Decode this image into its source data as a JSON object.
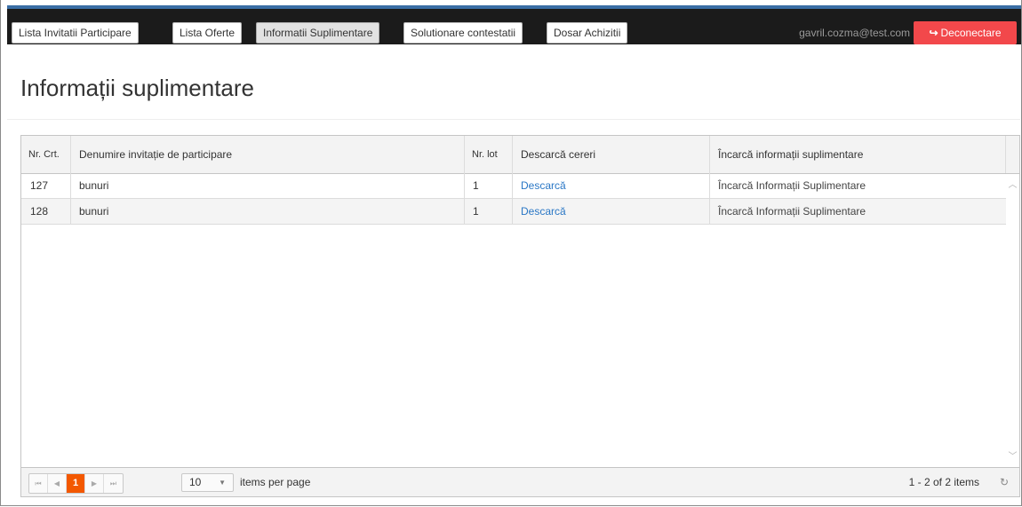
{
  "nav": {
    "items": [
      {
        "label": "Lista Invitatii Participare",
        "active": false
      },
      {
        "label": "Lista Oferte",
        "active": false
      },
      {
        "label": "Informatii Suplimentare",
        "active": true
      },
      {
        "label": "Solutionare contestatii",
        "active": false
      },
      {
        "label": "Dosar Achizitii",
        "active": false
      }
    ],
    "user_email": "gavril.cozma@test.com",
    "logout_label": "Deconectare",
    "logout_icon": "logout-icon",
    "accent_color": "#f2484b"
  },
  "page": {
    "title": "Informații suplimentare"
  },
  "grid": {
    "headers": {
      "nr_crt": "Nr. Crt.",
      "denumire": "Denumire invitație de participare",
      "nr_lot": "Nr. lot",
      "descarca": "Descarcă cereri",
      "incarca": "Încarcă informații suplimentare"
    },
    "rows": [
      {
        "nr": "127",
        "denumire": "bunuri",
        "lot": "1",
        "descarca": "Descarcă",
        "incarca": "Încarcă Informații Suplimentare"
      },
      {
        "nr": "128",
        "denumire": "bunuri",
        "lot": "1",
        "descarca": "Descarcă",
        "incarca": "Încarcă Informații Suplimentare"
      }
    ],
    "pager": {
      "current_page": "1",
      "page_size": "10",
      "page_size_label": "items per page",
      "info": "1 - 2 of 2 items",
      "current_color": "#f35800"
    }
  }
}
